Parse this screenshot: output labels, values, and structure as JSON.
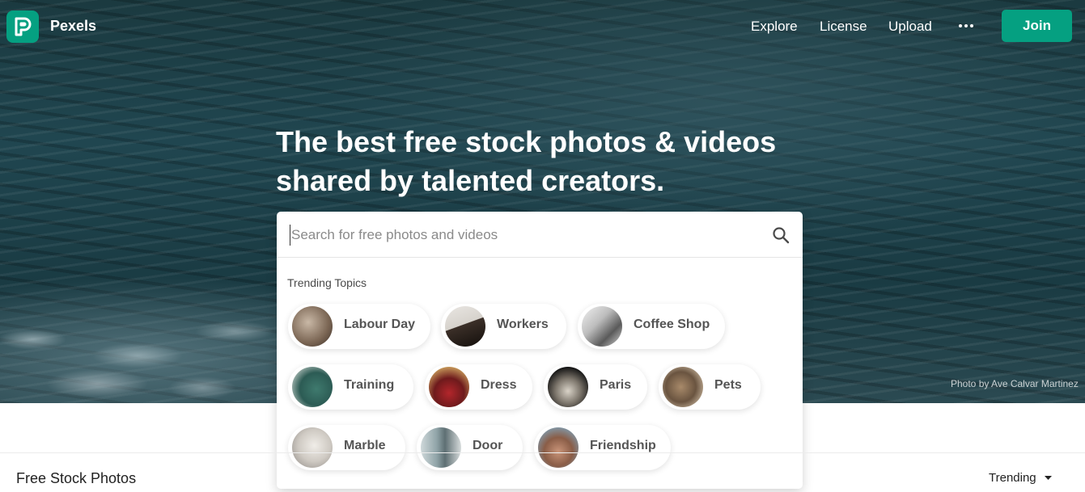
{
  "header": {
    "brand": "Pexels",
    "nav": [
      "Explore",
      "License",
      "Upload"
    ],
    "more_icon": "more-horizontal-icon",
    "join_label": "Join"
  },
  "hero": {
    "headline_line1": "The best free stock photos & videos",
    "headline_line2": "shared by talented creators.",
    "photo_credit": "Photo by Ave Calvar Martinez"
  },
  "search": {
    "placeholder": "Search for free photos and videos",
    "value": "",
    "icon": "search-icon",
    "trending_label": "Trending Topics",
    "topics": [
      "Labour Day",
      "Workers",
      "Coffee Shop",
      "Training",
      "Dress",
      "Paris",
      "Pets",
      "Marble",
      "Door",
      "Friendship"
    ]
  },
  "section": {
    "title": "Free Stock Photos",
    "sort_value": "Trending"
  },
  "colors": {
    "brand_green": "#05a081",
    "water_dark": "#1b3a40"
  }
}
